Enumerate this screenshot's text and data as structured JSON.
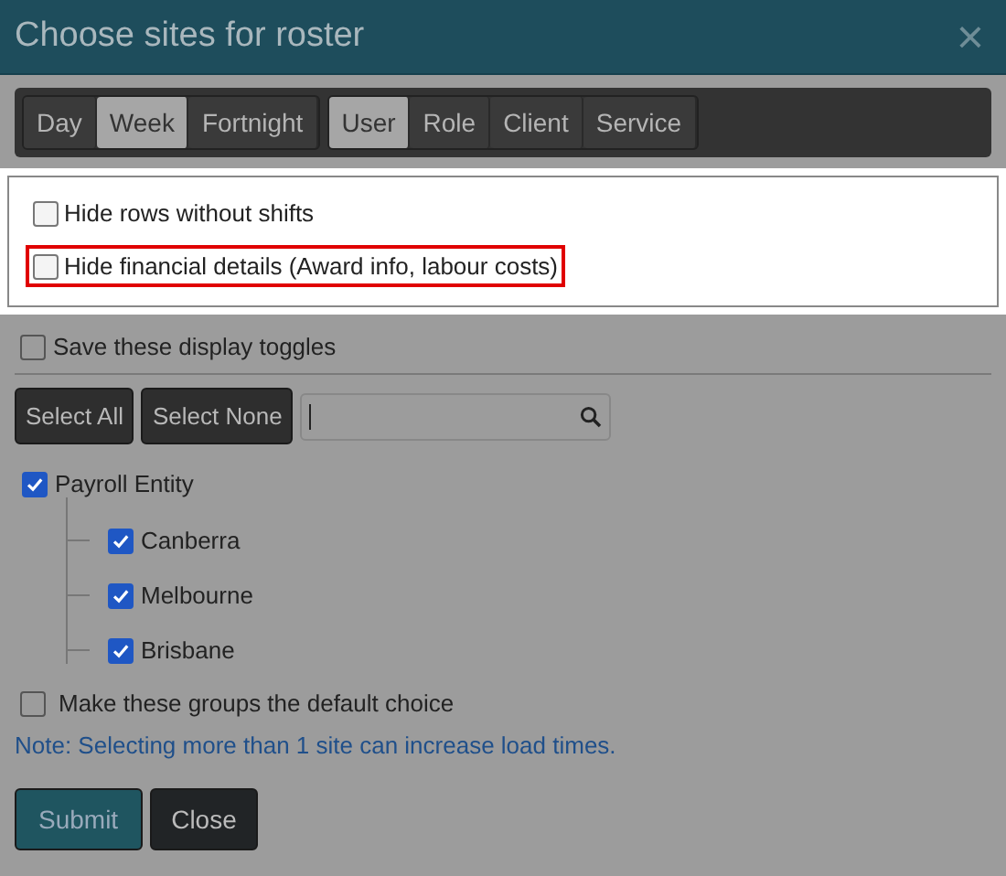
{
  "window": {
    "title": "Choose sites for roster",
    "close": "×"
  },
  "tab_groups": [
    [
      {
        "label": "Day",
        "selected": false
      },
      {
        "label": "Week",
        "selected": true
      },
      {
        "label": "Fortnight",
        "selected": false
      }
    ],
    [
      {
        "label": "User",
        "selected": true
      },
      {
        "label": "Role",
        "selected": false
      },
      {
        "label": "Client",
        "selected": false
      },
      {
        "label": "Service",
        "selected": false
      }
    ]
  ],
  "display_options": [
    {
      "label": "Hide rows without shifts",
      "checked": false,
      "highlighted": false
    },
    {
      "label": "Hide financial details (Award info, labour costs)",
      "checked": false,
      "highlighted": true
    }
  ],
  "save_toggles": {
    "label": "Save these display toggles",
    "checked": false
  },
  "select_buttons": [
    "Select All",
    "Select None"
  ],
  "tree": {
    "label": "Payroll Entity",
    "checked": true,
    "children": [
      {
        "label": "Canberra",
        "checked": true
      },
      {
        "label": "Melbourne",
        "checked": true
      },
      {
        "label": "Brisbane",
        "checked": true
      }
    ]
  },
  "default_choice": {
    "label": "Make these groups the default choice",
    "checked": false
  },
  "note": "Note: Selecting more than 1 site can increase load times.",
  "buttons": [
    {
      "label": "Submit",
      "kind": "primary"
    },
    {
      "label": "Close",
      "kind": "dark"
    }
  ]
}
